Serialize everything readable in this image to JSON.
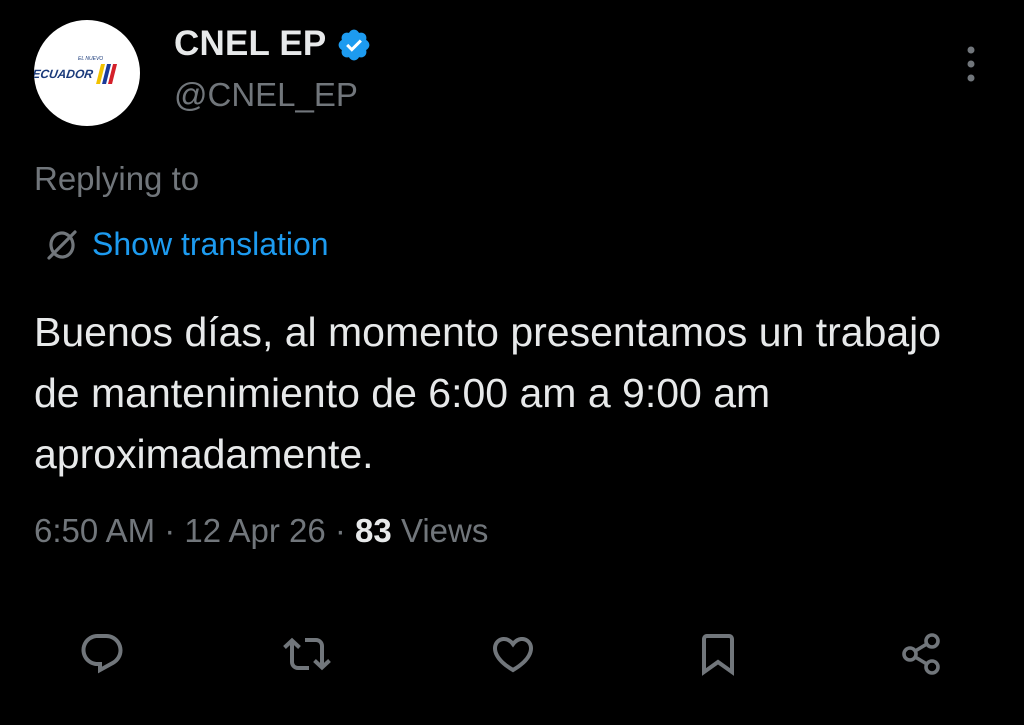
{
  "tweet": {
    "author": {
      "display_name": "CNEL EP",
      "handle": "@CNEL_EP",
      "verified": true,
      "avatar_logo_text": "ECUADOR",
      "avatar_logo_small_text": "EL NUEVO"
    },
    "replying_to_label": "Replying to",
    "translation_label": "Show translation",
    "text": "Buenos días, al momento presentamos un trabajo de mantenimiento de 6:00 am a 9:00 am aproximadamente.",
    "time": "6:50 AM",
    "date": "12 Apr 26",
    "separator": "·",
    "views_count": "83",
    "views_label": "Views"
  },
  "actions": [
    {
      "name": "reply",
      "icon": "reply-icon"
    },
    {
      "name": "retweet",
      "icon": "retweet-icon"
    },
    {
      "name": "like",
      "icon": "heart-icon"
    },
    {
      "name": "bookmark",
      "icon": "bookmark-icon"
    },
    {
      "name": "share",
      "icon": "share-icon"
    }
  ],
  "colors": {
    "background": "#000000",
    "text_primary": "#e7e9ea",
    "text_secondary": "#71767b",
    "link": "#1d9bf0",
    "verified_badge": "#1d9bf0",
    "icon": "#71767b"
  }
}
